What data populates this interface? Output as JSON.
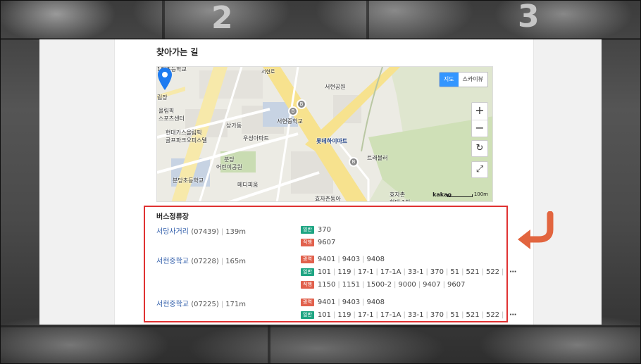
{
  "colors": {
    "accent_blue": "#3396ff",
    "badge_green": "#1fa583",
    "badge_red": "#e1614d",
    "highlight": "#e03232",
    "arrow": "#e2653f",
    "link": "#3662ad"
  },
  "section_title": "찾아가는 길",
  "map": {
    "type_buttons": [
      {
        "label": "지도",
        "active": true
      },
      {
        "label": "스카이뷰",
        "active": false
      }
    ],
    "zoom_in": "+",
    "zoom_out": "−",
    "labels": [
      "1현초등학교",
      "림장",
      "올림픽\n스포츠센터",
      "현대카스올림픽\n골프파크오피스텔",
      "상가동",
      "서현중학교",
      "우성아파트",
      "서현공원",
      "롯데하이마트",
      "트래블러",
      "분당\n어린이공원",
      "메디피움",
      "분당초등학교",
      "효자촌동아",
      "효자촌\n현대 1차",
      "서현로"
    ],
    "kakao_logo": "kakao",
    "scale_label": "100m",
    "icons": [
      "marker-icon",
      "bus-icon",
      "refresh-icon",
      "fullscreen-icon"
    ]
  },
  "bus": {
    "title": "버스정류장",
    "stops": [
      {
        "name": "서당사거리",
        "code": "(07439)",
        "distance": "139m",
        "routes": [
          {
            "type": "일반",
            "color": "green",
            "numbers": [
              "370"
            ],
            "more": false
          },
          {
            "type": "직행",
            "color": "red",
            "numbers": [
              "9607"
            ],
            "more": false
          }
        ]
      },
      {
        "name": "서현중학교",
        "code": "(07228)",
        "distance": "165m",
        "routes": [
          {
            "type": "광역",
            "color": "red",
            "numbers": [
              "9401",
              "9403",
              "9408"
            ],
            "more": false
          },
          {
            "type": "일반",
            "color": "green",
            "numbers": [
              "101",
              "119",
              "17-1",
              "17-1A",
              "33-1",
              "370",
              "51",
              "521",
              "522"
            ],
            "more": true
          },
          {
            "type": "직행",
            "color": "red",
            "numbers": [
              "1150",
              "1151",
              "1500-2",
              "9000",
              "9407",
              "9607"
            ],
            "more": false
          }
        ]
      },
      {
        "name": "서현중학교",
        "code": "(07225)",
        "distance": "171m",
        "routes": [
          {
            "type": "광역",
            "color": "red",
            "numbers": [
              "9401",
              "9403",
              "9408"
            ],
            "more": false
          },
          {
            "type": "일반",
            "color": "green",
            "numbers": [
              "101",
              "119",
              "17-1",
              "17-1A",
              "33-1",
              "370",
              "51",
              "521",
              "522"
            ],
            "more": true
          }
        ]
      }
    ],
    "more_glyph": "⋯"
  },
  "background_digits": [
    "2",
    "3"
  ]
}
